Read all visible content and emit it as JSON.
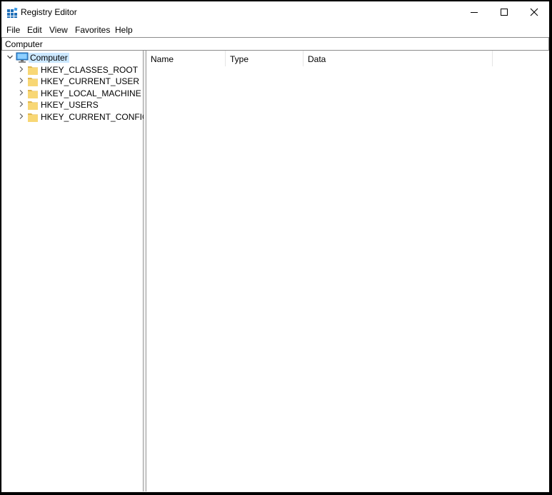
{
  "window": {
    "title": "Registry Editor"
  },
  "menu": {
    "items": [
      "File",
      "Edit",
      "View",
      "Favorites",
      "Help"
    ]
  },
  "address": {
    "path": "Computer"
  },
  "tree": {
    "root": "Computer",
    "hives": [
      "HKEY_CLASSES_ROOT",
      "HKEY_CURRENT_USER",
      "HKEY_LOCAL_MACHINE",
      "HKEY_USERS",
      "HKEY_CURRENT_CONFIG"
    ]
  },
  "list": {
    "columns": [
      "Name",
      "Type",
      "Data"
    ]
  },
  "colors": {
    "selection": "#cce8ff",
    "folder": "#f8d775",
    "folder_dark": "#e0b64f",
    "app_blue": "#1f6fb8"
  }
}
